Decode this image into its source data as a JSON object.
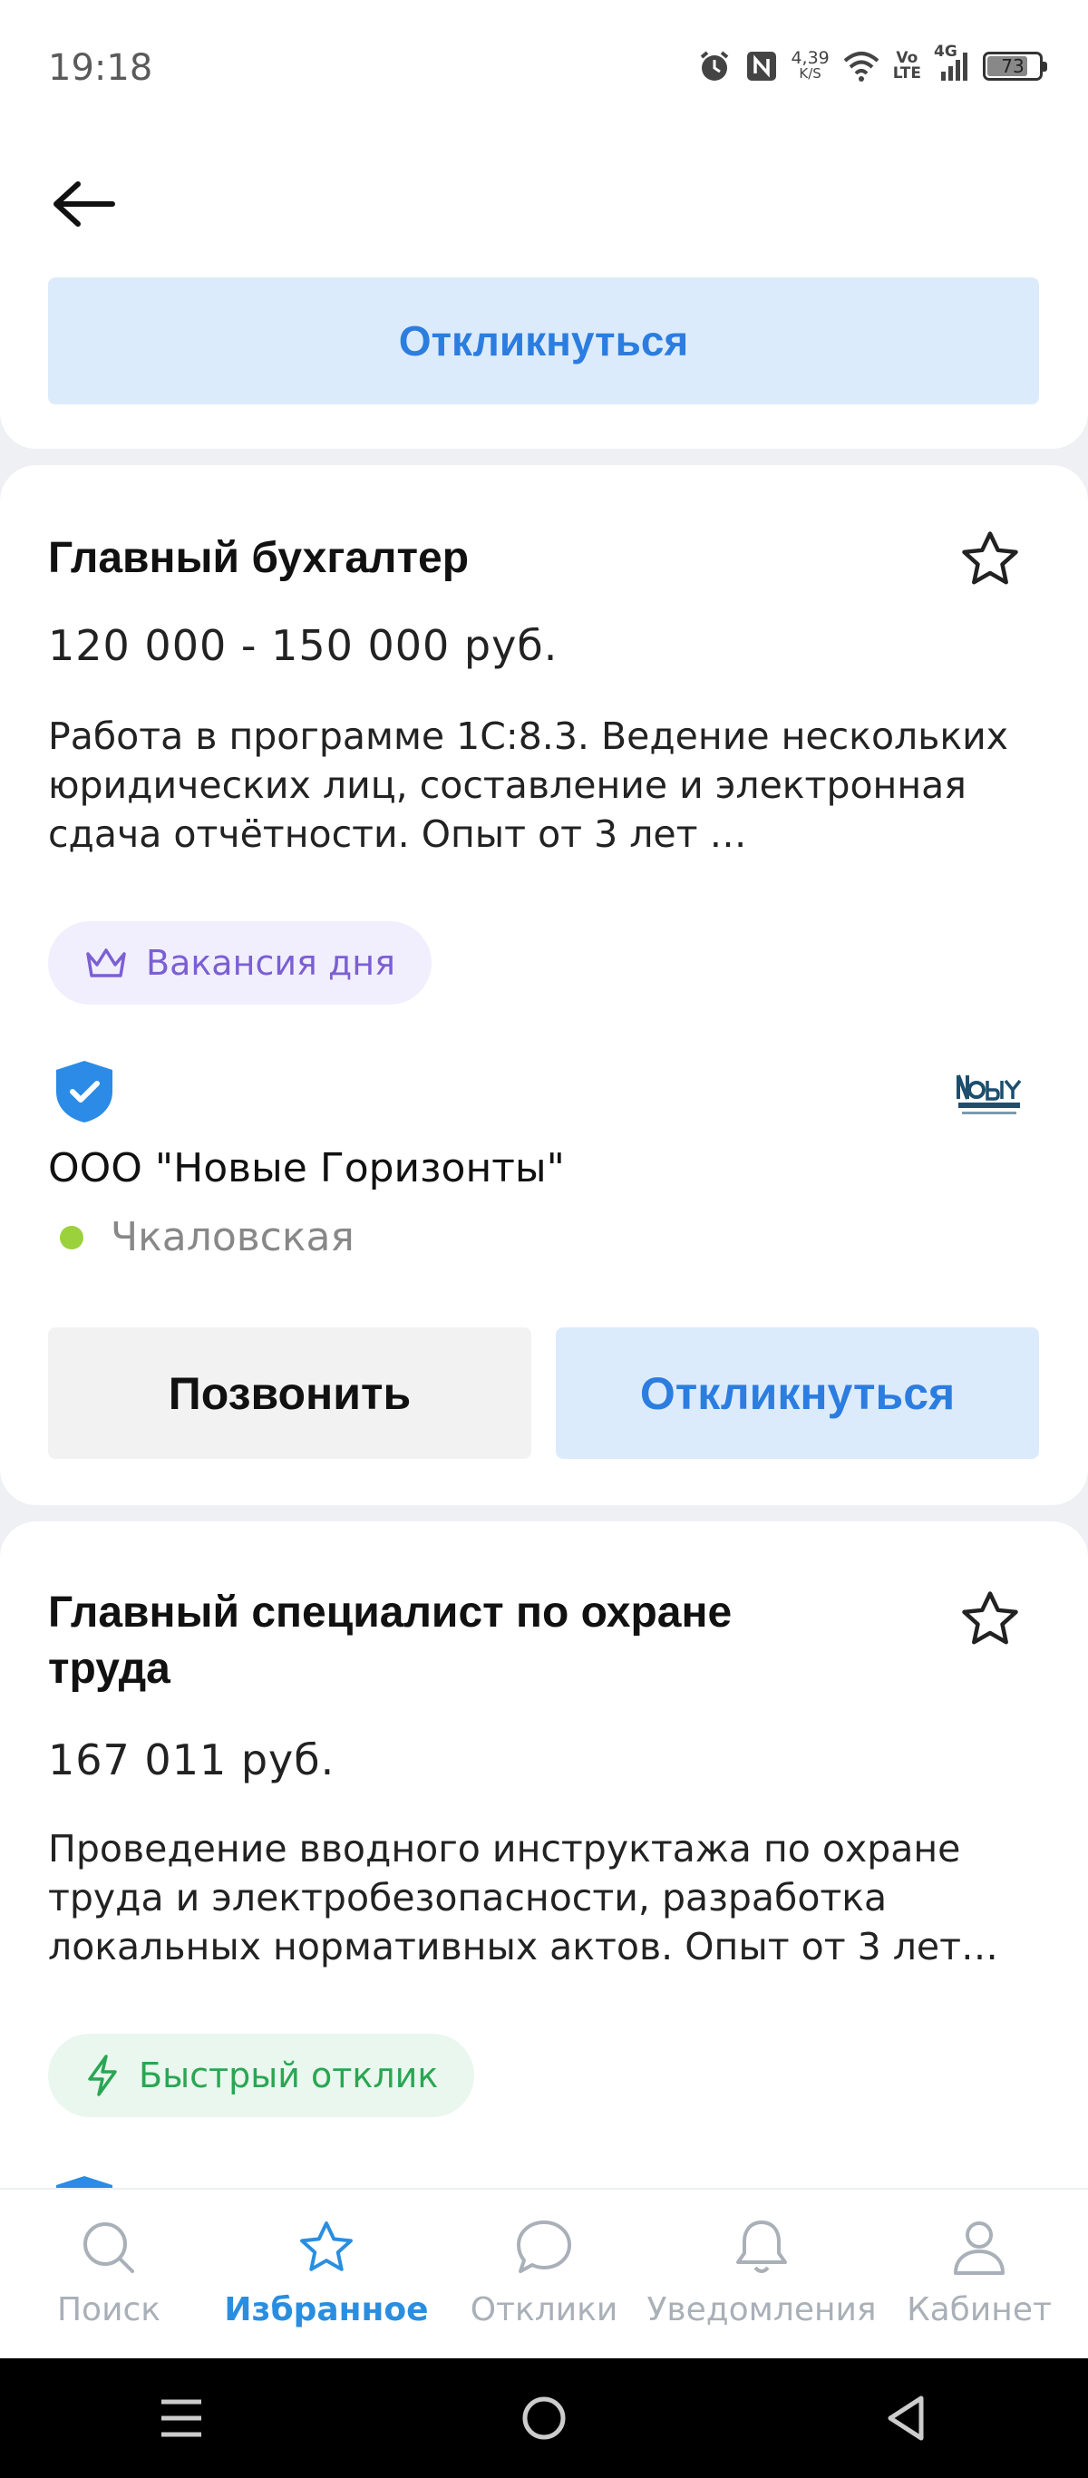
{
  "status_bar": {
    "time": "19:18",
    "network_speed_value": "4,39",
    "network_speed_unit": "K/S",
    "volte_top": "Vo",
    "volte_bottom": "LTE",
    "signal_label": "4G",
    "battery": "73"
  },
  "previous_card": {
    "respond_label": "Откликнуться"
  },
  "jobs": [
    {
      "title": "Главный бухгалтер",
      "salary": "120 000 - 150 000 руб.",
      "description": "Работа в программе 1С:8.3. Ведение нескольких юридических лиц, составление и электронная сдача отчётности. Опыт от 3 лет …",
      "badge": "Вакансия дня",
      "company": "ООО \"Новые Горизонты\"",
      "metro": "Чкаловская",
      "call_label": "Позвонить",
      "respond_label": "Откликнуться"
    },
    {
      "title": "Главный специалист по охране труда",
      "salary": "167 011 руб.",
      "description": "Проведение вводного инструктажа по охране труда и электробезопасности, разработка локальных нормативных актов. Опыт от 3 лет…",
      "badge": "Быстрый отклик"
    }
  ],
  "bottom_nav": {
    "items": [
      {
        "label": "Поиск",
        "icon": "search-icon"
      },
      {
        "label": "Избранное",
        "icon": "star-icon"
      },
      {
        "label": "Отклики",
        "icon": "chat-icon"
      },
      {
        "label": "Уведомления",
        "icon": "bell-icon"
      },
      {
        "label": "Кабинет",
        "icon": "user-icon"
      }
    ],
    "active": "Избранное"
  },
  "colors": {
    "accent_blue": "#2b7de0",
    "button_blue_bg": "#dcebfb",
    "badge_purple": "#7b5fd4",
    "badge_green": "#2aa653",
    "nav_active": "#2a8ee0",
    "metro_dot": "#9bd23c"
  }
}
